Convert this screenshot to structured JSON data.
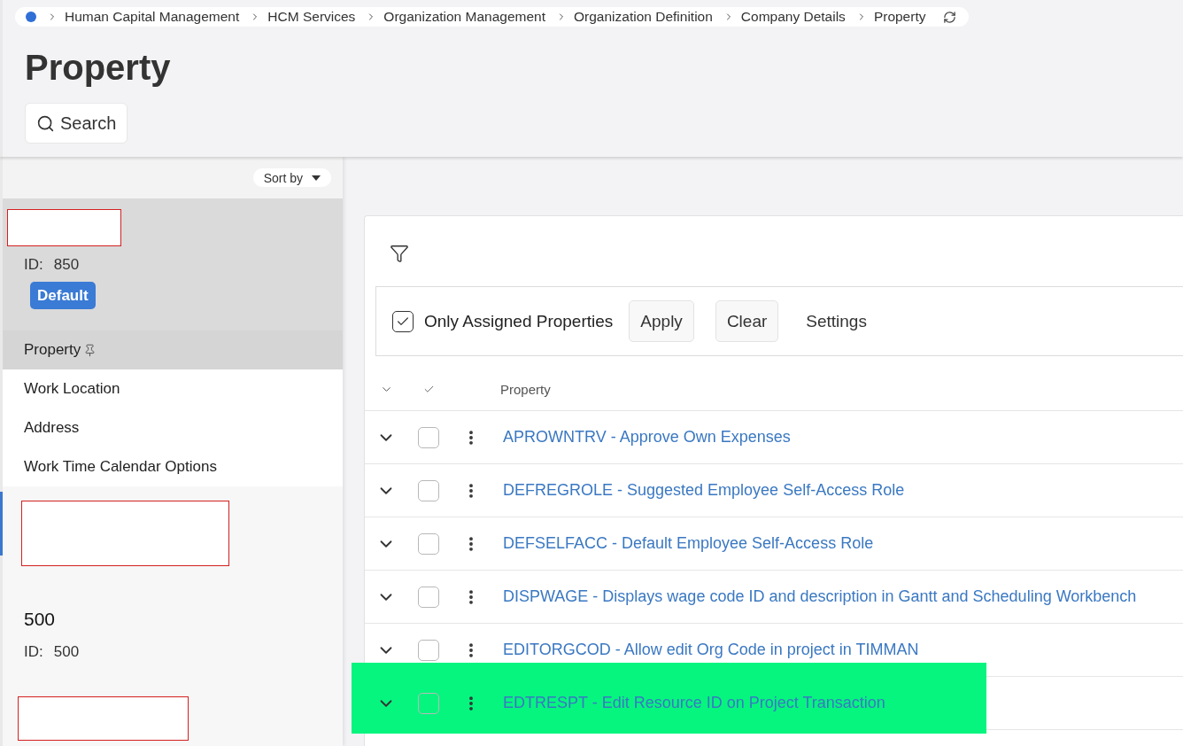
{
  "breadcrumb": {
    "items": [
      "Human Capital Management",
      "HCM Services",
      "Organization Management",
      "Organization Definition",
      "Company Details",
      "Property"
    ]
  },
  "page_title": "Property",
  "search_button": {
    "label": "Search"
  },
  "sort": {
    "label": "Sort by"
  },
  "companies": [
    {
      "selected": true,
      "current": false,
      "lines": [
        {
          "kind": "redacted"
        },
        {
          "kind": "id",
          "label": "ID:",
          "value": "850"
        },
        {
          "kind": "badge",
          "text": "Default"
        }
      ],
      "nav": [
        {
          "label": "Property",
          "selected": true,
          "pinned": true
        },
        {
          "label": "Work Location",
          "selected": false,
          "pinned": false
        },
        {
          "label": "Address",
          "selected": false,
          "pinned": false
        },
        {
          "label": "Work Time Calendar Options",
          "selected": false,
          "pinned": false
        }
      ]
    },
    {
      "selected": false,
      "current": true,
      "lines": [
        {
          "kind": "redacted"
        },
        {
          "kind": "name",
          "text": "500"
        },
        {
          "kind": "id",
          "label": "ID:",
          "value": "500"
        }
      ]
    },
    {
      "selected": false,
      "current": false,
      "lines": [
        {
          "kind": "redacted"
        }
      ]
    }
  ],
  "filter_bar": {
    "only_assigned": {
      "label": "Only Assigned Properties",
      "checked": true
    },
    "buttons": [
      {
        "label": "Apply",
        "kind": "button"
      },
      {
        "label": "Clear",
        "kind": "button"
      },
      {
        "label": "Settings",
        "kind": "text"
      }
    ]
  },
  "table": {
    "columns": [
      "Property"
    ],
    "rows": [
      {
        "text": "APROWNTRV - Approve Own Expenses",
        "checked": false,
        "highlighted": false
      },
      {
        "text": "DEFREGROLE - Suggested Employee Self-Access Role",
        "checked": false,
        "highlighted": false
      },
      {
        "text": "DEFSELFACC - Default Employee Self-Access Role",
        "checked": false,
        "highlighted": false
      },
      {
        "text": "DISPWAGE - Displays wage code ID and description in Gantt and Scheduling Workbench",
        "checked": false,
        "highlighted": false
      },
      {
        "text": "EDITORGCOD - Allow edit Org Code in project in TIMMAN",
        "checked": false,
        "highlighted": false
      },
      {
        "text": "EDTRESPT - Edit Resource ID on Project Transaction",
        "checked": false,
        "highlighted": true
      }
    ]
  }
}
